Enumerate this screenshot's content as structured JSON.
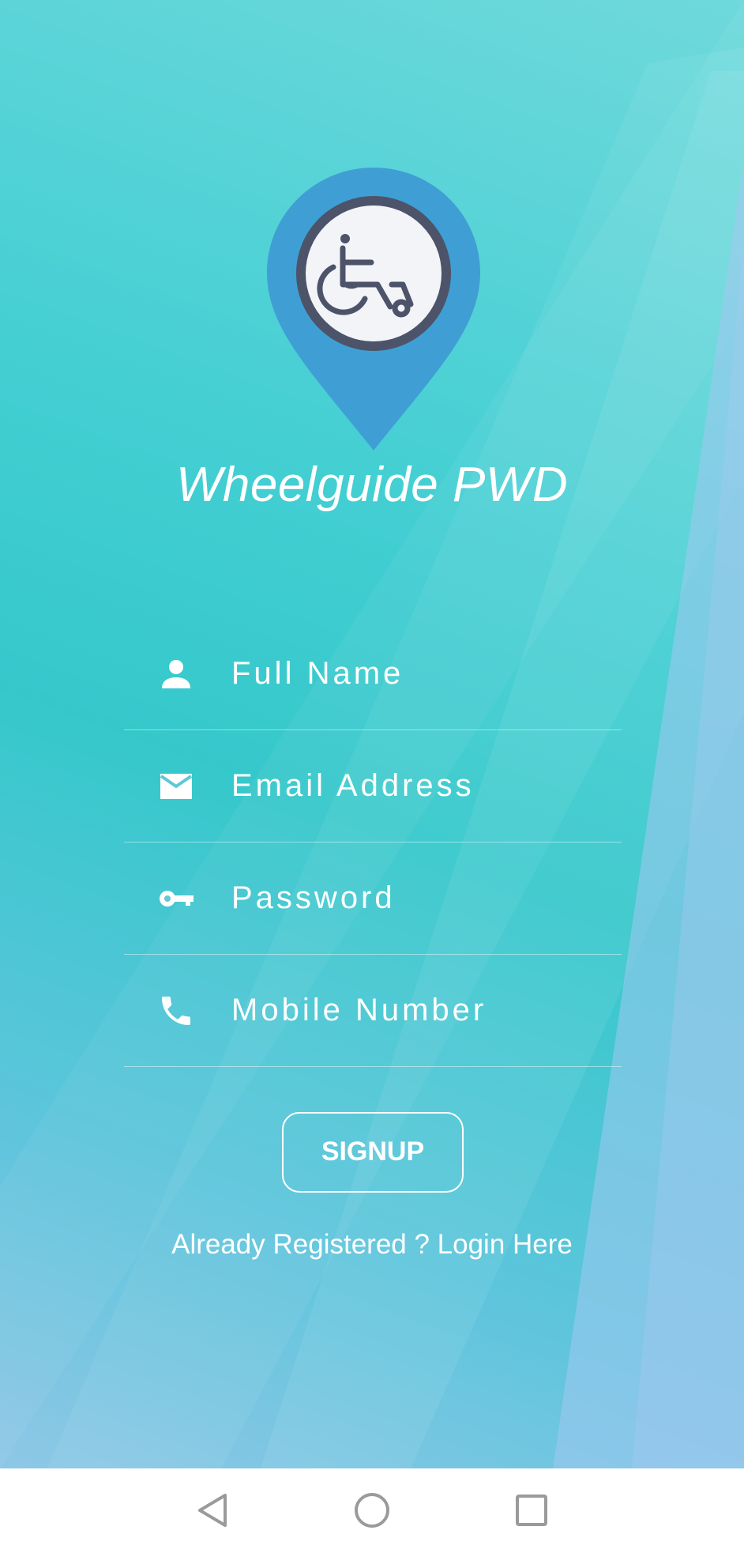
{
  "app": {
    "title": "Wheelguide PWD"
  },
  "form": {
    "fields": [
      {
        "name": "full-name",
        "icon": "person-icon",
        "placeholder": "Full Name",
        "value": ""
      },
      {
        "name": "email-address",
        "icon": "email-icon",
        "placeholder": "Email Address",
        "value": ""
      },
      {
        "name": "password",
        "icon": "key-icon",
        "placeholder": "Password",
        "value": ""
      },
      {
        "name": "mobile-number",
        "icon": "phone-icon",
        "placeholder": "Mobile Number",
        "value": ""
      }
    ],
    "signup_label": "SIGNUP",
    "login_link": "Already Registered ? Login Here"
  },
  "logo": {
    "icon": "wheelchair-location-pin-icon",
    "pin_color": "#3f9fd4",
    "ring_color": "#4d5368",
    "inner_color": "#f2f4f8"
  },
  "navbar": {
    "buttons": [
      "back-icon",
      "home-icon",
      "recents-icon"
    ]
  },
  "colors": {
    "text": "#ffffff",
    "navbar_bg": "#ffffff",
    "nav_icon": "#9a9a9a"
  }
}
